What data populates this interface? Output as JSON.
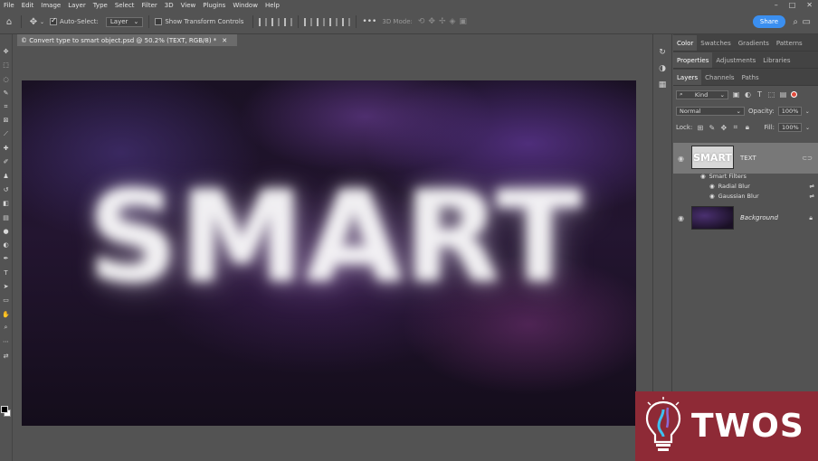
{
  "menu": [
    "File",
    "Edit",
    "Image",
    "Layer",
    "Type",
    "Select",
    "Filter",
    "3D",
    "View",
    "Plugins",
    "Window",
    "Help"
  ],
  "options_bar": {
    "auto_select_label": "Auto-Select:",
    "auto_select_target": "Layer",
    "show_transform_label": "Show Transform Controls",
    "mode_3d_label": "3D Mode:",
    "share_label": "Share"
  },
  "document": {
    "tab_title": "© Convert type to smart object.psd @ 50.2% (TEXT, RGB/8) *",
    "canvas_text": "SMART"
  },
  "panels": {
    "row1_tabs": [
      "Color",
      "Swatches",
      "Gradients",
      "Patterns"
    ],
    "row2_tabs": [
      "Properties",
      "Adjustments",
      "Libraries"
    ],
    "row3_tabs": [
      "Layers",
      "Channels",
      "Paths"
    ],
    "filter_kind": "Kind",
    "blend_mode": "Normal",
    "opacity_label": "Opacity:",
    "opacity_value": "100%",
    "lock_label": "Lock:",
    "fill_label": "Fill:",
    "fill_value": "100%"
  },
  "layers": {
    "text_layer": "TEXT",
    "text_thumb": "SMART",
    "smart_filters": "Smart Filters",
    "filter_1": "Radial Blur",
    "filter_2": "Gaussian Blur",
    "background_layer": "Background"
  },
  "watermark": {
    "text": "TWOS"
  },
  "colors": {
    "accent": "#3b8ff0",
    "watermark_bg": "#8e2a36"
  }
}
